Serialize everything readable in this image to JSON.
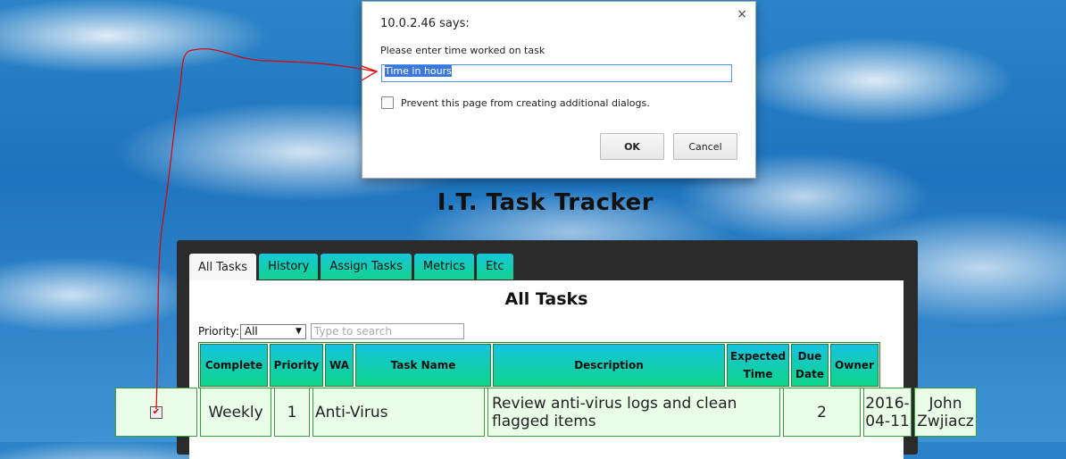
{
  "dialog": {
    "origin": "10.0.2.46 says:",
    "close": "×",
    "message": "Please enter time worked on task",
    "input_value": "Time in hours",
    "prevent_label": "Prevent this page from creating additional dialogs.",
    "ok_label": "OK",
    "cancel_label": "Cancel"
  },
  "page_title": "I.T. Task Tracker",
  "tabs": [
    "All Tasks",
    "History",
    "Assign Tasks",
    "Metrics",
    "Etc"
  ],
  "content": {
    "heading": "All Tasks",
    "priority_label": "Priority:",
    "priority_value": "All",
    "search_placeholder": "Type to search"
  },
  "table": {
    "headers": [
      "Complete",
      "Priority",
      "WA",
      "Task Name",
      "Description",
      "Expected Time",
      "Due Date",
      "Owner"
    ],
    "row": {
      "priority": "Weekly",
      "wa": "1",
      "task_name": "Anti-Virus",
      "description": "Review anti-virus logs and clean flagged items",
      "expected_time": "2",
      "due_date": "2016-04-11",
      "owner": "John Zwjiacz"
    }
  },
  "colors": {
    "tab_gradient_top": "#16c7d8",
    "tab_gradient_bottom": "#13d38e",
    "row_bg": "#e9fde9",
    "row_border": "#3a9e3a",
    "annotation": "#e00000"
  }
}
